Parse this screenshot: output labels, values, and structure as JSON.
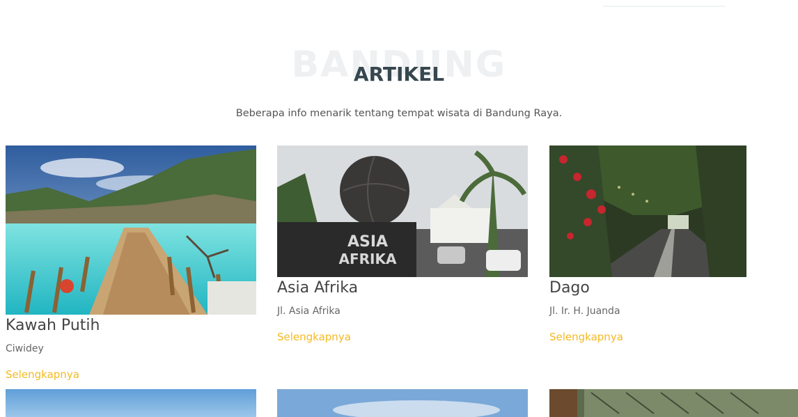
{
  "section": {
    "background_word": "BANDUNG",
    "title": "ARTIKEL",
    "subtitle": "Beberapa info menarik tentang tempat wisata di Bandung Raya."
  },
  "articles": [
    {
      "name": "Kawah Putih",
      "address": "Ciwidey",
      "more": "Selengkapnya"
    },
    {
      "name": "Asia Afrika",
      "address": "Jl. Asia Afrika",
      "more": "Selengkapnya"
    },
    {
      "name": "Dago",
      "address": "Jl. Ir. H. Juanda",
      "more": "Selengkapnya"
    }
  ],
  "photo_labels": {
    "asia_afrika_sign": [
      "ASIA",
      "AFRIKA"
    ]
  },
  "colors": {
    "accent": "#f5b921",
    "title": "#37474f",
    "watermark": "#eef0f2"
  }
}
